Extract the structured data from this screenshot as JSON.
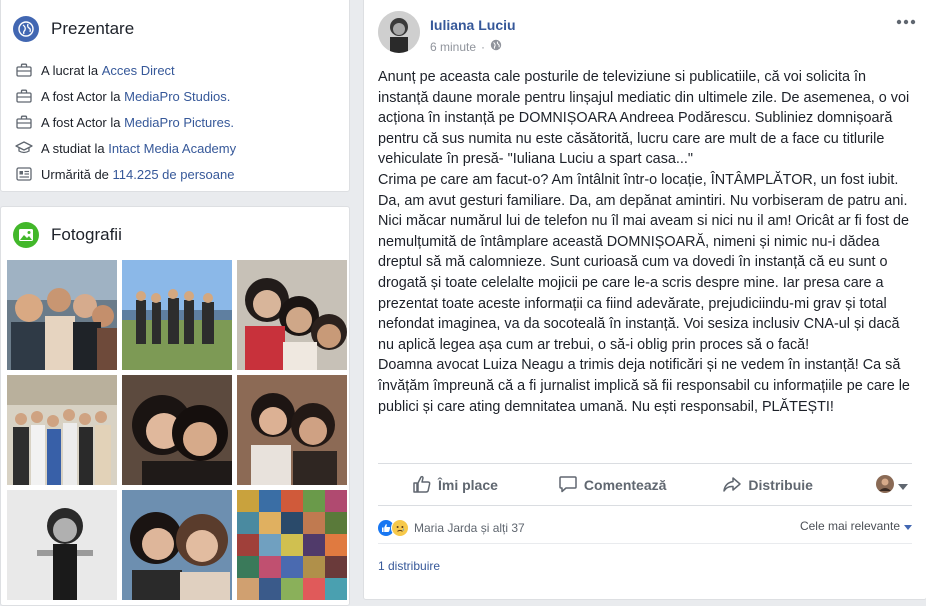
{
  "intro": {
    "title": "Prezentare",
    "items": [
      {
        "icon": "briefcase-icon",
        "prefix": "A lucrat la ",
        "link": "Acces Direct",
        "suffix": ""
      },
      {
        "icon": "briefcase-icon",
        "prefix": "A fost Actor la ",
        "link": "MediaPro Studios",
        "suffix": "."
      },
      {
        "icon": "briefcase-icon",
        "prefix": "A fost Actor la ",
        "link": "MediaPro Pictures",
        "suffix": "."
      },
      {
        "icon": "graduation-cap-icon",
        "prefix": "A studiat la ",
        "link": "Intact Media Academy",
        "suffix": ""
      },
      {
        "icon": "followers-icon",
        "prefix": "Urmărită de ",
        "link": "114.225 de persoane",
        "suffix": ""
      }
    ]
  },
  "photos": {
    "title": "Fotografii"
  },
  "post": {
    "author": "Iuliana Luciu",
    "time": "6 minute",
    "separator": "·",
    "paragraphs": [
      "Anunț pe aceasta cale posturile de televiziune si publicatiile, că voi solicita în instanță daune morale pentru linșajul mediatic din ultimele zile. De asemenea, o voi acționa în instanță pe DOMNIȘOARA Andreea Podărescu. Subliniez domnișoară pentru că sus numita nu este căsătorită, lucru care are mult de a face cu titlurile vehiculate în presă- \"Iuliana Luciu a spart casa...\"",
      "Crima pe care am facut-o? Am întâlnit într-o locație, ÎNTÂMPLĂTOR, un fost iubit. Da, am avut gesturi familiare. Da, am depănat amintiri. Nu vorbiseram de patru ani. Nici măcar numărul lui de telefon nu îl mai aveam si nici nu il am! Oricât ar fi fost de nemulțumită de întâmplare această DOMNIȘOARĂ, nimeni și nimic nu-i dădea dreptul să mă calomnieze. Sunt curioasă cum va dovedi în instanță că eu sunt o drogată și toate celelalte mojicii pe care le-a scris despre mine. Iar presa care a prezentat toate aceste informații ca fiind adevărate, prejudiciindu-mi grav și total nefondat imaginea, va da socoteală în instanță. Voi sesiza inclusiv CNA-ul și dacă nu aplică legea așa cum ar trebui, o să-i oblig prin proces să o facă!",
      "Doamna avocat Luiza Neagu a trimis deja notificări și ne vedem în instanță! Ca să învățăm împreună că a fi jurnalist implică să fii responsabil cu informațiile pe care le publici și care ating demnitatea umană. Nu ești responsabil, PLĂTEȘTI!"
    ],
    "actions": {
      "like": "Îmi place",
      "comment": "Comentează",
      "share": "Distribuie"
    },
    "reactions": {
      "text": "Maria Jarda și alți 37",
      "icons": [
        "like-reaction-icon",
        "sad-reaction-icon"
      ]
    },
    "sort": "Cele mai relevante",
    "shares": "1 distribuire"
  },
  "colors": {
    "link": "#365899",
    "like_blue": "#1877f2",
    "sad_yellow": "#f7c94b"
  }
}
